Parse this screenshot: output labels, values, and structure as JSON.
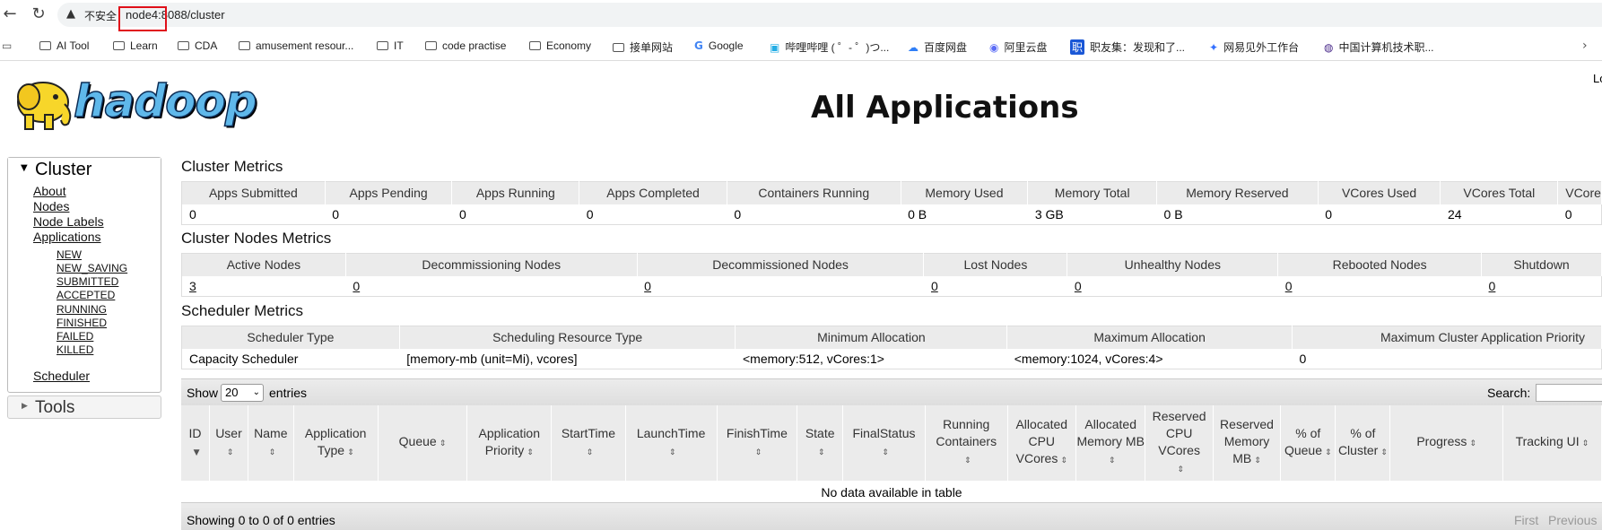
{
  "browser": {
    "warning": "不安全",
    "url": "node4:8088/cluster",
    "bookmarks": [
      {
        "icon": "folder",
        "label": "AI Tool"
      },
      {
        "icon": "folder",
        "label": "Learn"
      },
      {
        "icon": "folder",
        "label": "CDA"
      },
      {
        "icon": "folder",
        "label": "amusement resour..."
      },
      {
        "icon": "folder",
        "label": "IT"
      },
      {
        "icon": "folder",
        "label": "code practise"
      },
      {
        "icon": "folder",
        "label": "Economy"
      },
      {
        "icon": "folder",
        "label": "接单网站"
      },
      {
        "icon": "google-icon",
        "label": "Google"
      },
      {
        "icon": "bilibili-icon",
        "label": "哔哩哔哩 ( ゜- ゜)つ..."
      },
      {
        "icon": "baidu-icon",
        "label": "百度网盘"
      },
      {
        "icon": "aliyun-icon",
        "label": "阿里云盘"
      },
      {
        "icon": "zhiyou-icon",
        "label": "职友集：发现和了..."
      },
      {
        "icon": "netease-icon",
        "label": "网易见外工作台"
      },
      {
        "icon": "cnki-icon",
        "label": "中国计算机技术职..."
      }
    ]
  },
  "header": {
    "logo_text": "hadoop",
    "title": "All Applications",
    "corner": "Lo"
  },
  "sidebar": {
    "cluster_title": "Cluster",
    "links": [
      "About",
      "Nodes",
      "Node Labels",
      "Applications"
    ],
    "app_states": [
      "NEW",
      "NEW_SAVING",
      "SUBMITTED",
      "ACCEPTED",
      "RUNNING",
      "FINISHED",
      "FAILED",
      "KILLED"
    ],
    "scheduler": "Scheduler",
    "tools_title": "Tools"
  },
  "cluster_metrics": {
    "title": "Cluster Metrics",
    "headers": [
      "Apps Submitted",
      "Apps Pending",
      "Apps Running",
      "Apps Completed",
      "Containers Running",
      "Memory Used",
      "Memory Total",
      "Memory Reserved",
      "VCores Used",
      "VCores Total",
      "VCore"
    ],
    "values": [
      "0",
      "0",
      "0",
      "0",
      "0",
      "0 B",
      "3 GB",
      "0 B",
      "0",
      "24",
      "0"
    ]
  },
  "node_metrics": {
    "title": "Cluster Nodes Metrics",
    "headers": [
      "Active Nodes",
      "Decommissioning Nodes",
      "Decommissioned Nodes",
      "Lost Nodes",
      "Unhealthy Nodes",
      "Rebooted Nodes",
      "Shutdown"
    ],
    "values": [
      "3",
      "0",
      "0",
      "0",
      "0",
      "0",
      "0"
    ]
  },
  "scheduler_metrics": {
    "title": "Scheduler Metrics",
    "headers": [
      "Scheduler Type",
      "Scheduling Resource Type",
      "Minimum Allocation",
      "Maximum Allocation",
      "Maximum Cluster Application Priority"
    ],
    "values": [
      "Capacity Scheduler",
      "[memory-mb (unit=Mi), vcores]",
      "<memory:512, vCores:1>",
      "<memory:1024, vCores:4>",
      "0"
    ]
  },
  "apps_table": {
    "show_label": "Show",
    "page_size": "20",
    "entries_label": "entries",
    "search_label": "Search:",
    "columns": [
      "ID",
      "User",
      "Name",
      "Application Type",
      "Queue",
      "Application Priority",
      "StartTime",
      "LaunchTime",
      "FinishTime",
      "State",
      "FinalStatus",
      "Running Containers",
      "Allocated CPU VCores",
      "Allocated Memory MB",
      "Reserved CPU VCores",
      "Reserved Memory MB",
      "% of Queue",
      "% of Cluster",
      "Progress",
      "Tracking UI"
    ],
    "empty_text": "No data available in table",
    "info": "Showing 0 to 0 of 0 entries",
    "first": "First",
    "previous": "Previous"
  }
}
